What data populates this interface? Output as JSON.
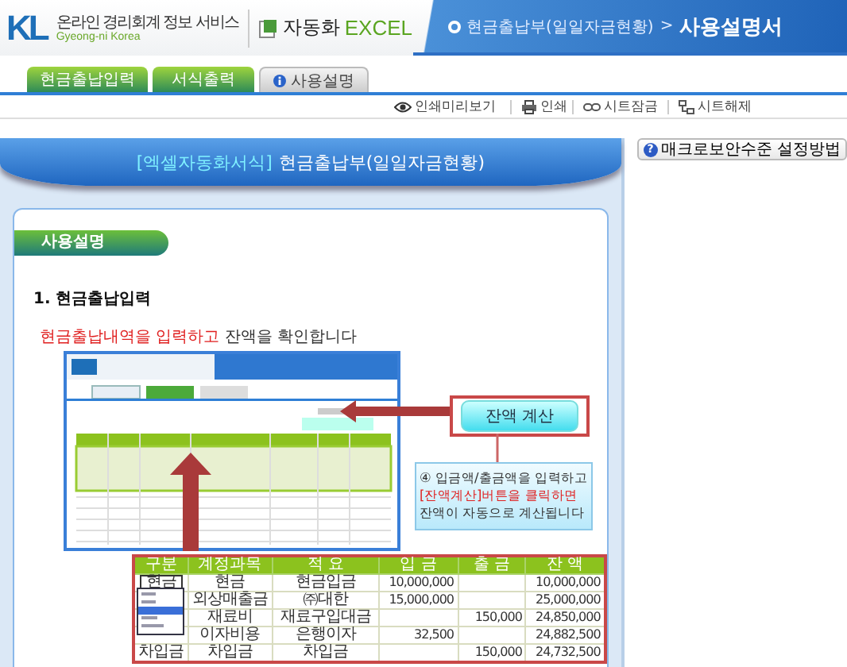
{
  "header": {
    "logo": "KL",
    "service_name": "온라인 경리회계 정보 서비스",
    "service_name_en": "Gyeong-ni Korea",
    "product_name": "자동화",
    "product_suffix": "EXCEL",
    "breadcrumb": {
      "parent": "현금출납부(일일자금현황)",
      "separator": ">",
      "current": "사용설명서"
    }
  },
  "tabs": [
    {
      "label": "현금출납입력",
      "selected": false
    },
    {
      "label": "서식출력",
      "selected": false
    },
    {
      "label": "사용설명",
      "selected": true
    }
  ],
  "toolbar": [
    {
      "kind": "preview",
      "label": "인쇄미리보기"
    },
    {
      "kind": "print",
      "label": "인쇄"
    },
    {
      "kind": "lock",
      "label": "시트잠금"
    },
    {
      "kind": "unlock",
      "label": "시트해제"
    }
  ],
  "banner": {
    "tag": "[엑셀자동화서식]",
    "title": "현금출납부(일일자금현황)"
  },
  "help_button": {
    "icon": "?",
    "label": "매크로보안수준 설정방법"
  },
  "section": {
    "heading": "사용설명",
    "step": "1. 현금출납입력",
    "instruction": {
      "highlight": "현금출납내역을 입력하고",
      "rest": " 잔액을 확인합니다"
    }
  },
  "callout": {
    "button": "잔액 계산",
    "lines": [
      {
        "text": "④ 입금액/출금액을 입력하고",
        "highlight": false
      },
      {
        "text": "[잔액계산]버튼을 클릭하면",
        "highlight": true
      },
      {
        "text": "잔액이 자동으로 계산됩니다",
        "highlight": false
      }
    ]
  },
  "ledger": {
    "columns": [
      "구분",
      "계정과목",
      "적 요",
      "입 금",
      "출 금",
      "잔 액"
    ],
    "rows": [
      {
        "group_select": "현금",
        "account": "현금",
        "memo": "현금입금",
        "deposit": "10,000,000",
        "balance": "10,000,000"
      },
      {
        "account": "외상매출금",
        "memo": "㈜대한",
        "deposit": "15,000,000",
        "balance": "25,000,000"
      },
      {
        "account": "재료비",
        "memo": "재료구입대금",
        "withdrawal": "150,000",
        "balance": "24,850,000"
      },
      {
        "account": "이자비용",
        "memo": "은행이자",
        "deposit": "32,500",
        "balance": "24,882,500"
      },
      {
        "group": "차입금",
        "account": "차입금",
        "memo": "차입금",
        "withdrawal": "150,000",
        "balance": "24,732,500"
      }
    ]
  }
}
